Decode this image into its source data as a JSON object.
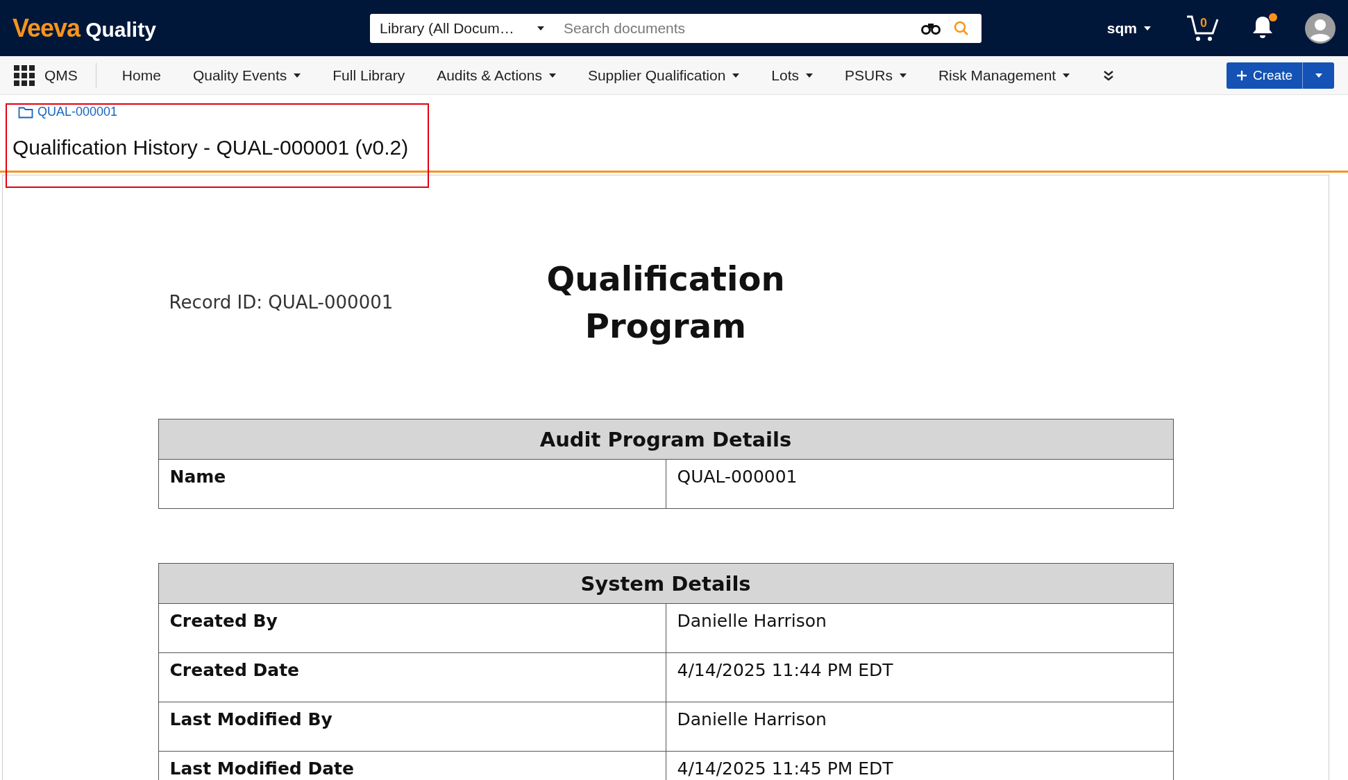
{
  "top_bar": {
    "logo_brand": "Veeva",
    "logo_product": "Quality",
    "search_scope": "Library (All Docum…",
    "search": {
      "placeholder": "Search documents"
    },
    "user": "sqm",
    "cart_count": "0",
    "notifications_unread": true
  },
  "nav": {
    "app_name": "QMS",
    "items": [
      {
        "label": "Home",
        "dropdown": false
      },
      {
        "label": "Quality Events",
        "dropdown": true
      },
      {
        "label": "Full Library",
        "dropdown": false
      },
      {
        "label": "Audits & Actions",
        "dropdown": true
      },
      {
        "label": "Supplier Qualification",
        "dropdown": true
      },
      {
        "label": "Lots",
        "dropdown": true
      },
      {
        "label": "PSURs",
        "dropdown": true
      },
      {
        "label": "Risk Management",
        "dropdown": true
      }
    ],
    "create_button": "Create"
  },
  "header": {
    "breadcrumb": "QUAL-000001",
    "title": "Qualification History - QUAL-000001 (v0.2)",
    "highlighted": true
  },
  "document": {
    "record_id": "Record ID: QUAL-000001",
    "title": "Qualification Program",
    "tables": [
      {
        "heading": "Audit Program Details",
        "rows": [
          {
            "label": "Name",
            "value": "QUAL-000001"
          }
        ]
      },
      {
        "heading": "System Details",
        "rows": [
          {
            "label": "Created By",
            "value": "Danielle Harrison"
          },
          {
            "label": "Created Date",
            "value": "4/14/2025 11:44 PM EDT"
          },
          {
            "label": "Last Modified By",
            "value": "Danielle Harrison"
          },
          {
            "label": "Last Modified Date",
            "value": "4/14/2025 11:45 PM EDT"
          }
        ]
      }
    ]
  }
}
